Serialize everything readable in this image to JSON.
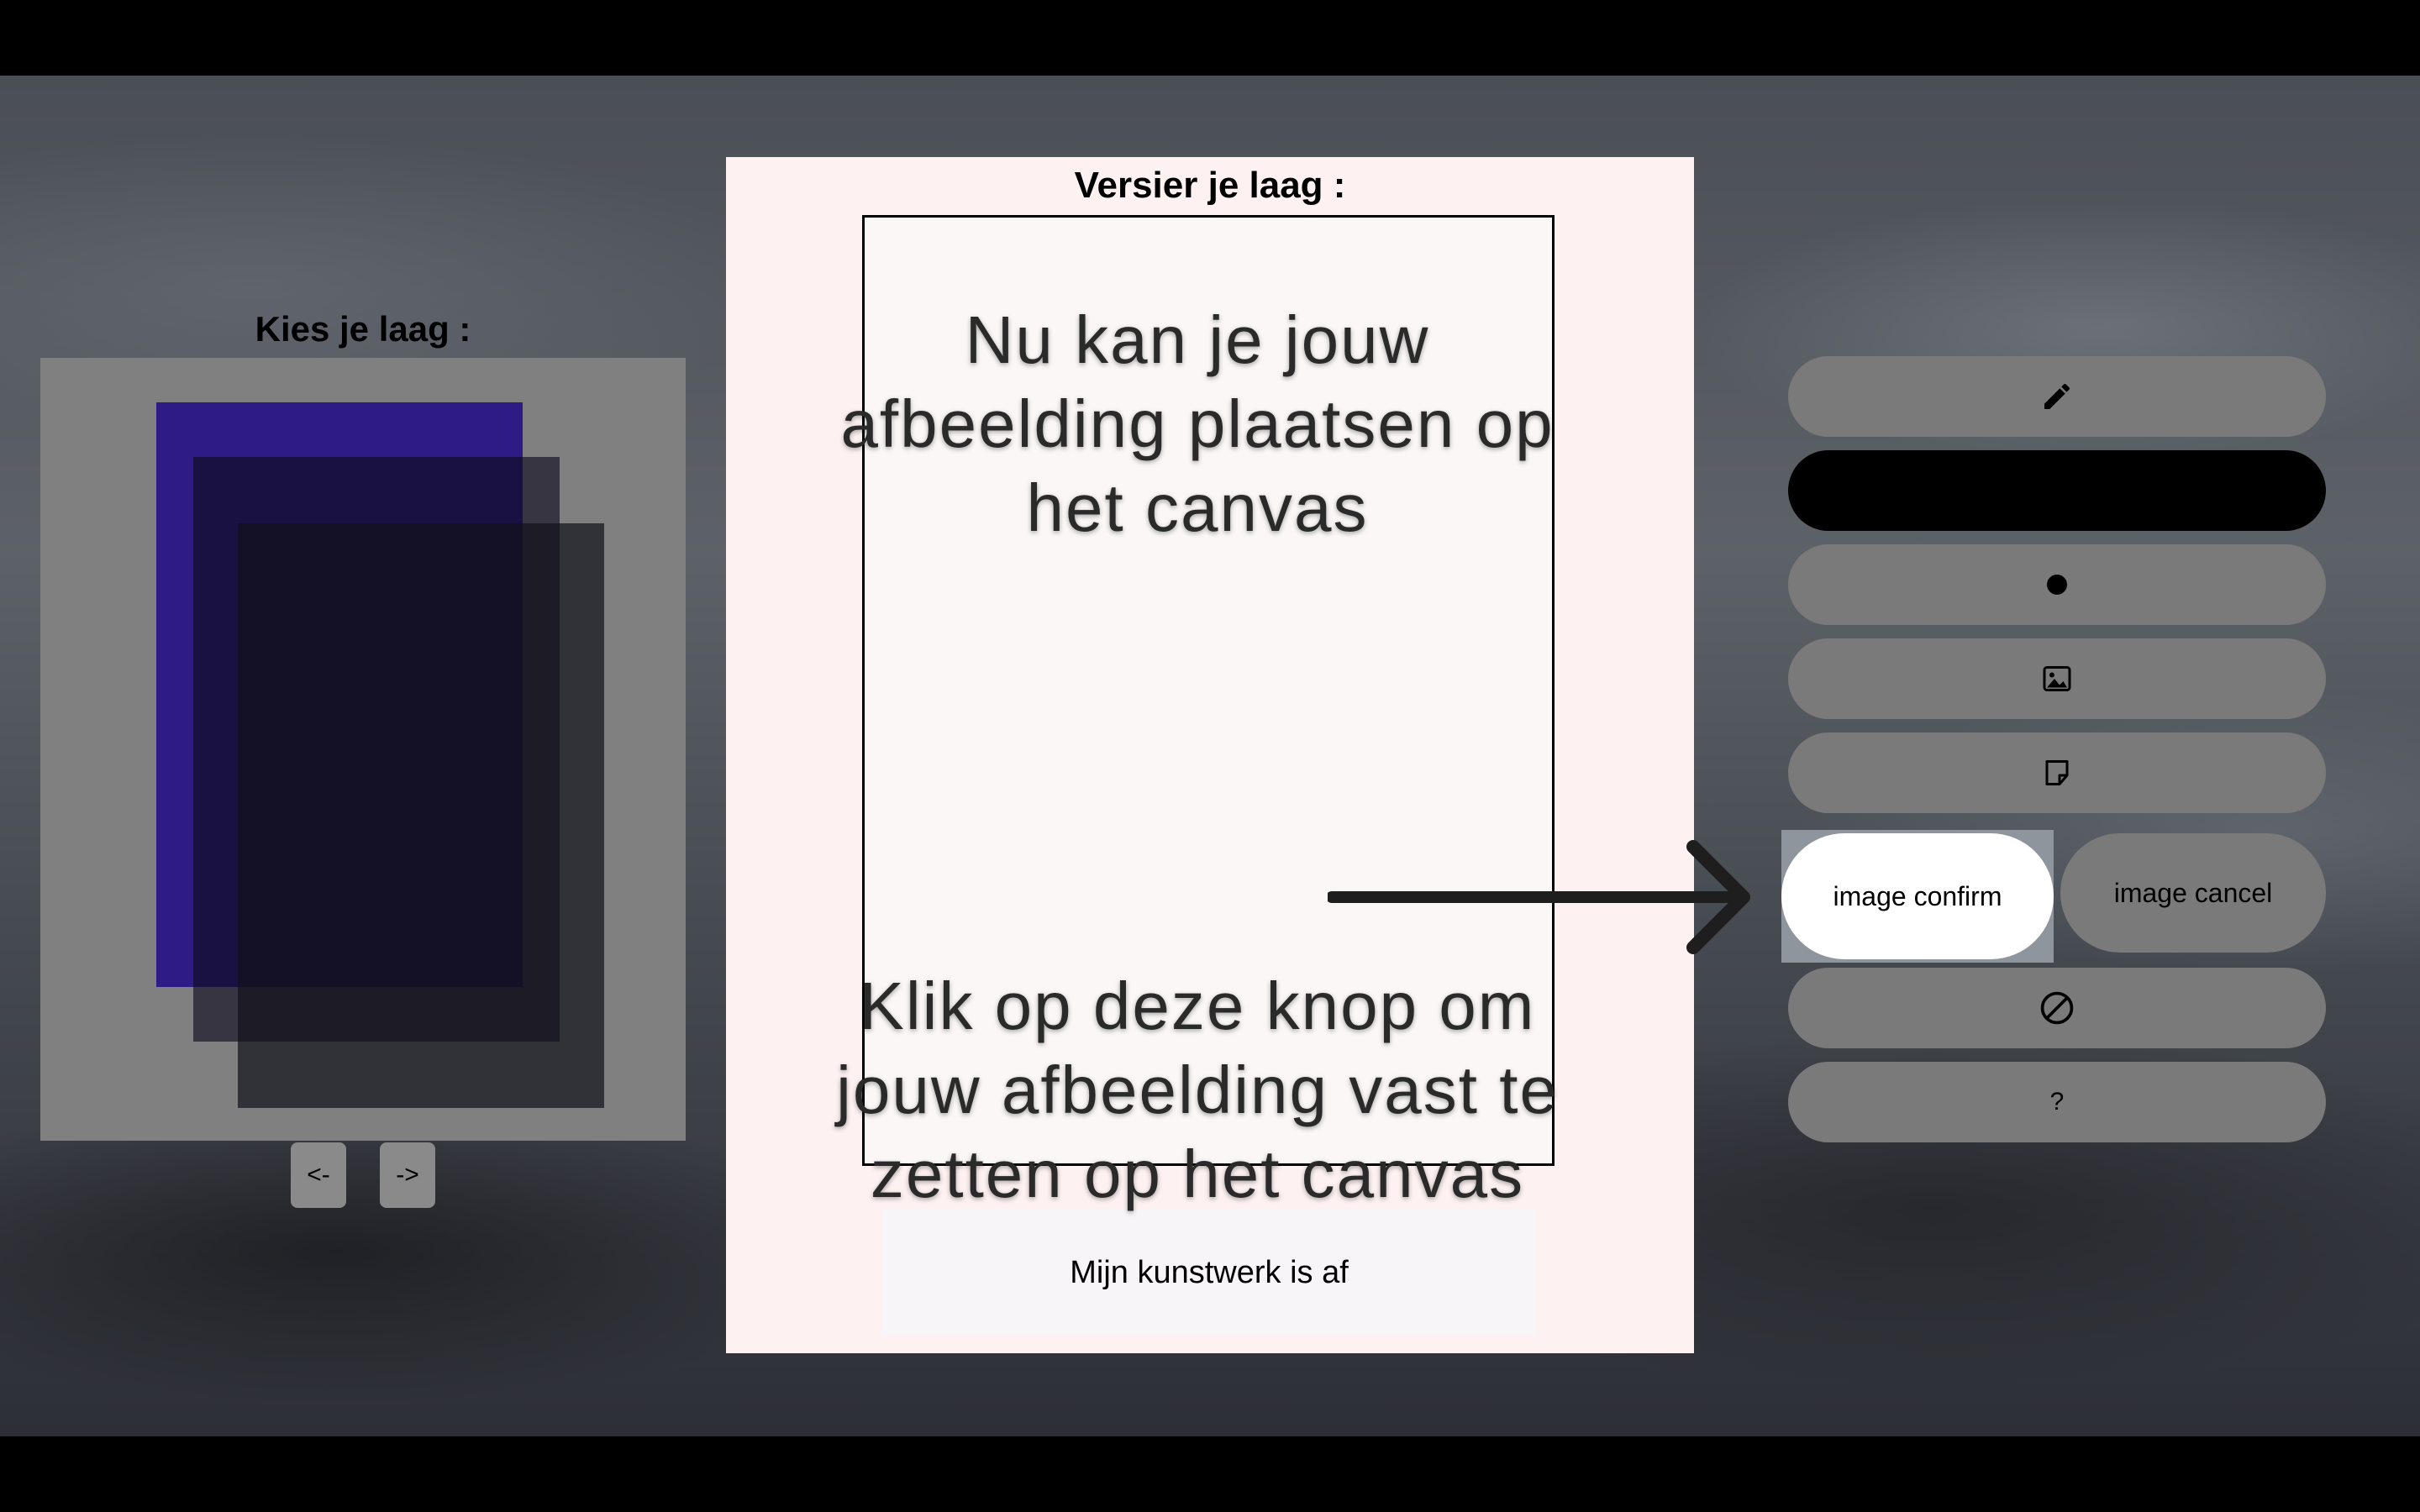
{
  "layer_picker": {
    "title": "Kies je laag :",
    "prev_label": "<-",
    "next_label": "->",
    "layer_colors": [
      "#2f1b86",
      "#1a1630",
      "#15151f"
    ]
  },
  "editor": {
    "title": "Versier je laag :",
    "finish_label": "Mijn kunstwerk is af"
  },
  "tutorial": {
    "top_text": "Nu kan je jouw afbeelding plaatsen op het canvas",
    "bottom_text": "Klik op deze knop om jouw afbeelding vast te zetten op het canvas"
  },
  "toolbar": {
    "pen_icon": "pencil-icon",
    "color_value": "#000000",
    "size_icon": "dot-icon",
    "image_icon": "image-icon",
    "sticker_icon": "sticky-note-icon",
    "image_confirm_label": "image confirm",
    "image_cancel_label": "image cancel",
    "clear_icon": "prohibited-icon",
    "help_label": "?"
  }
}
